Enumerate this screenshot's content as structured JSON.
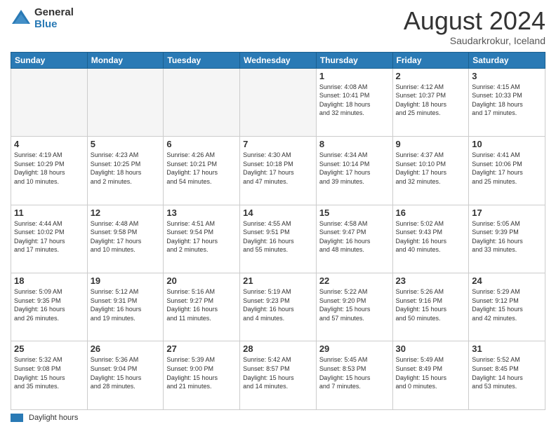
{
  "logo": {
    "general": "General",
    "blue": "Blue"
  },
  "title": {
    "month_year": "August 2024",
    "location": "Saudarkrokur, Iceland"
  },
  "weekdays": [
    "Sunday",
    "Monday",
    "Tuesday",
    "Wednesday",
    "Thursday",
    "Friday",
    "Saturday"
  ],
  "weeks": [
    [
      {
        "day": "",
        "info": ""
      },
      {
        "day": "",
        "info": ""
      },
      {
        "day": "",
        "info": ""
      },
      {
        "day": "",
        "info": ""
      },
      {
        "day": "1",
        "info": "Sunrise: 4:08 AM\nSunset: 10:41 PM\nDaylight: 18 hours\nand 32 minutes."
      },
      {
        "day": "2",
        "info": "Sunrise: 4:12 AM\nSunset: 10:37 PM\nDaylight: 18 hours\nand 25 minutes."
      },
      {
        "day": "3",
        "info": "Sunrise: 4:15 AM\nSunset: 10:33 PM\nDaylight: 18 hours\nand 17 minutes."
      }
    ],
    [
      {
        "day": "4",
        "info": "Sunrise: 4:19 AM\nSunset: 10:29 PM\nDaylight: 18 hours\nand 10 minutes."
      },
      {
        "day": "5",
        "info": "Sunrise: 4:23 AM\nSunset: 10:25 PM\nDaylight: 18 hours\nand 2 minutes."
      },
      {
        "day": "6",
        "info": "Sunrise: 4:26 AM\nSunset: 10:21 PM\nDaylight: 17 hours\nand 54 minutes."
      },
      {
        "day": "7",
        "info": "Sunrise: 4:30 AM\nSunset: 10:18 PM\nDaylight: 17 hours\nand 47 minutes."
      },
      {
        "day": "8",
        "info": "Sunrise: 4:34 AM\nSunset: 10:14 PM\nDaylight: 17 hours\nand 39 minutes."
      },
      {
        "day": "9",
        "info": "Sunrise: 4:37 AM\nSunset: 10:10 PM\nDaylight: 17 hours\nand 32 minutes."
      },
      {
        "day": "10",
        "info": "Sunrise: 4:41 AM\nSunset: 10:06 PM\nDaylight: 17 hours\nand 25 minutes."
      }
    ],
    [
      {
        "day": "11",
        "info": "Sunrise: 4:44 AM\nSunset: 10:02 PM\nDaylight: 17 hours\nand 17 minutes."
      },
      {
        "day": "12",
        "info": "Sunrise: 4:48 AM\nSunset: 9:58 PM\nDaylight: 17 hours\nand 10 minutes."
      },
      {
        "day": "13",
        "info": "Sunrise: 4:51 AM\nSunset: 9:54 PM\nDaylight: 17 hours\nand 2 minutes."
      },
      {
        "day": "14",
        "info": "Sunrise: 4:55 AM\nSunset: 9:51 PM\nDaylight: 16 hours\nand 55 minutes."
      },
      {
        "day": "15",
        "info": "Sunrise: 4:58 AM\nSunset: 9:47 PM\nDaylight: 16 hours\nand 48 minutes."
      },
      {
        "day": "16",
        "info": "Sunrise: 5:02 AM\nSunset: 9:43 PM\nDaylight: 16 hours\nand 40 minutes."
      },
      {
        "day": "17",
        "info": "Sunrise: 5:05 AM\nSunset: 9:39 PM\nDaylight: 16 hours\nand 33 minutes."
      }
    ],
    [
      {
        "day": "18",
        "info": "Sunrise: 5:09 AM\nSunset: 9:35 PM\nDaylight: 16 hours\nand 26 minutes."
      },
      {
        "day": "19",
        "info": "Sunrise: 5:12 AM\nSunset: 9:31 PM\nDaylight: 16 hours\nand 19 minutes."
      },
      {
        "day": "20",
        "info": "Sunrise: 5:16 AM\nSunset: 9:27 PM\nDaylight: 16 hours\nand 11 minutes."
      },
      {
        "day": "21",
        "info": "Sunrise: 5:19 AM\nSunset: 9:23 PM\nDaylight: 16 hours\nand 4 minutes."
      },
      {
        "day": "22",
        "info": "Sunrise: 5:22 AM\nSunset: 9:20 PM\nDaylight: 15 hours\nand 57 minutes."
      },
      {
        "day": "23",
        "info": "Sunrise: 5:26 AM\nSunset: 9:16 PM\nDaylight: 15 hours\nand 50 minutes."
      },
      {
        "day": "24",
        "info": "Sunrise: 5:29 AM\nSunset: 9:12 PM\nDaylight: 15 hours\nand 42 minutes."
      }
    ],
    [
      {
        "day": "25",
        "info": "Sunrise: 5:32 AM\nSunset: 9:08 PM\nDaylight: 15 hours\nand 35 minutes."
      },
      {
        "day": "26",
        "info": "Sunrise: 5:36 AM\nSunset: 9:04 PM\nDaylight: 15 hours\nand 28 minutes."
      },
      {
        "day": "27",
        "info": "Sunrise: 5:39 AM\nSunset: 9:00 PM\nDaylight: 15 hours\nand 21 minutes."
      },
      {
        "day": "28",
        "info": "Sunrise: 5:42 AM\nSunset: 8:57 PM\nDaylight: 15 hours\nand 14 minutes."
      },
      {
        "day": "29",
        "info": "Sunrise: 5:45 AM\nSunset: 8:53 PM\nDaylight: 15 hours\nand 7 minutes."
      },
      {
        "day": "30",
        "info": "Sunrise: 5:49 AM\nSunset: 8:49 PM\nDaylight: 15 hours\nand 0 minutes."
      },
      {
        "day": "31",
        "info": "Sunrise: 5:52 AM\nSunset: 8:45 PM\nDaylight: 14 hours\nand 53 minutes."
      }
    ]
  ],
  "footer": {
    "daylight_label": "Daylight hours"
  }
}
